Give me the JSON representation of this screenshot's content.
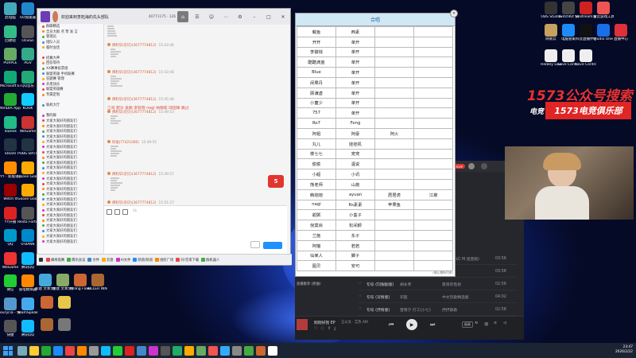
{
  "desktop_left": {
    "col1": [
      "此电脑",
      "回收站",
      "PURPLE",
      "Microsoft Edge",
      "NVIDIA App",
      "ToDesk",
      "Steam",
      "YY - 新版语音",
      "Witch It",
      "YY开播",
      "QQ",
      "WeGame",
      "微信",
      "eurycia - 快捷方式",
      "快捷"
    ],
    "col2": [
      "UU加速器",
      "Oculus",
      "AGV",
      "QQ音乐",
      "KOOK",
      "WeGame",
      "PUBG BATTLEGRO...",
      "Goose Goose Duck",
      "Goose Goose Duck",
      "Resto Fortune",
      "U-BANK",
      "腾讯QQ",
      "雷电模拟器",
      "TeamSpeak 3",
      "腾讯QQ"
    ],
    "col3": [
      "",
      "",
      "",
      "",
      "",
      "",
      "",
      "",
      "",
      "",
      "",
      "新建 文本文档",
      "新建 文本文档",
      "Killing Floor Beta Cook...",
      "KILLER INN BETA"
    ],
    "col3_colors": [
      "#b44",
      "#55a",
      "#fa0",
      "#3a8",
      "#e44",
      "#f80",
      "#48c",
      "#e8c84a",
      "#888",
      "#4a4",
      "#2a6",
      "#4ad",
      "#8a6",
      "#c63",
      "#a63"
    ]
  },
  "desktop_right": {
    "icons": [
      "OBS Studio",
      "TwitchKit 快捷方式",
      "Restream 快捷方式",
      "雷云游戏工具",
      "网易云",
      "电脑管家",
      "抖音直播伴侣",
      "Studio One 5",
      "直播中心",
      "HeiBey Love Contr...",
      "Love Control-R...",
      "Love Control-R..."
    ],
    "promo_line1": "1573公众号搜索",
    "promo_logo": "电竞",
    "promo_line2": "1573电竞俱乐部"
  },
  "chat": {
    "title": "欢迎来到李拓海的先头部队",
    "stats": "40771175 · 126",
    "input_placeholder": "Sk",
    "messages": [
      {
        "name": "佛利华(宗贝)(3677774812)",
        "time": "15:43:46"
      },
      {
        "name": "佛利华(宗贝)(3677774812)",
        "time": "15:43:48"
      },
      {
        "name": "佛利华(宗贝)(3677774812)",
        "time": "15:45:46",
        "body": "江哥 配对 姜鹏 李智晓 nagi 纳御帮 邱田铼 跳过"
      },
      {
        "name": "佛利华(宗贝)(3677774812)",
        "time": "15:49:53"
      },
      {
        "name": "阿福(77421006)",
        "time": "15:49:55"
      },
      {
        "name": "佛利华(宗贝)(3677774812)",
        "time": "15:49:57"
      },
      {
        "name": "佛利华(宗贝)(3677774812)",
        "time": "15:51:27"
      }
    ],
    "groups": [
      "群聊精选",
      "全员大群 点 赞 发 言",
      "管理员",
      "组队人员",
      "临时会话",
      "",
      "招募大神",
      "回答等待",
      "XX赛事投票组",
      "联盟英雄 手机联赛",
      "答题赛 管理",
      "开黑快乐",
      "联盟英雄赛",
      "专属定制",
      "",
      "联机大厅",
      "",
      "我的群",
      "大家大家好的朋友们",
      "大家大家好的朋友们",
      "大家大家好的朋友们",
      "大家大家好的朋友们",
      "大家大家好的朋友们",
      "大家大家好的朋友们",
      "大家大家好的朋友们",
      "大家大家好的朋友们",
      "大家大家好的朋友们",
      "大家大家好的朋友们",
      "大家大家好的朋友们",
      "大家大家好的朋友们",
      "大家大家好的朋友们",
      "大家大家好的朋友们",
      "大家大家好的朋友们",
      "大家大家好的朋友们",
      "大家大家好的朋友们",
      "大家大家好的朋友们",
      "大家大家好的朋友们",
      "大家大家好的朋友们",
      "大家大家好的朋友们",
      "大家大家好的朋友们",
      "大家大家好的朋友们",
      "大家大家好的朋友们"
    ],
    "bottom_bar": [
      "",
      "蜂窝观赛",
      "腾讯会议",
      "文件",
      "云盘",
      "AI文件",
      "频道/频道",
      "组织广场",
      "开/完来下载",
      "群机器人"
    ]
  },
  "roster": {
    "title": "合唱",
    "footer": "(确认最新列表)",
    "rows": [
      [
        "鲅鱼",
        "西素",
        "",
        ""
      ],
      [
        "开开",
        "单开",
        "",
        ""
      ],
      [
        "李徽钱",
        "单开",
        "",
        ""
      ],
      [
        "酷酷滴蓝",
        "单开",
        "",
        ""
      ],
      [
        "Blue",
        "单开",
        "",
        ""
      ],
      [
        "闲果丹",
        "单开",
        "",
        ""
      ],
      [
        "顾谦虚",
        "单开",
        "",
        ""
      ],
      [
        "小童少",
        "单开",
        "",
        ""
      ],
      [
        "757",
        "单开",
        "",
        ""
      ],
      [
        "Ro7",
        "Feng",
        "",
        ""
      ],
      [
        "阿祖",
        "阿豪",
        "阿火",
        ""
      ],
      [
        "丸儿",
        "娃娃机",
        "",
        ""
      ],
      [
        "楼七七",
        "宠宠",
        "",
        ""
      ],
      [
        "偷偷",
        "温说",
        "",
        ""
      ],
      [
        "小超",
        "小讯",
        "",
        ""
      ],
      [
        "熊老师",
        "山炮",
        "",
        ""
      ],
      [
        "韩炮炮",
        "ayuan",
        "居居虎",
        "江黛"
      ],
      [
        "nagi",
        "Rs素素",
        "苹果鱼",
        ""
      ],
      [
        "甜粥",
        "小盒子",
        "",
        ""
      ],
      [
        "倪莫尚",
        "松间鲟",
        "",
        ""
      ],
      [
        "兰施",
        "东子",
        "",
        ""
      ],
      [
        "阿猫",
        "若若",
        "",
        ""
      ],
      [
        "仙某人",
        "獅子",
        "",
        ""
      ],
      [
        "图灵",
        "安可",
        "",
        ""
      ]
    ]
  },
  "player": {
    "sidebar": [
      "直播歌单 (CMO)",
      "直播歌单 (原曲)"
    ],
    "tracks": [
      {
        "title": "",
        "artist": "",
        "album": "Cover (LC M.混音版)",
        "time": "03:56"
      },
      {
        "title": "",
        "artist": "",
        "album": "",
        "time": "03:58"
      },
      {
        "title": "句号 (DJ银剧版)",
        "artist": "胡永孝",
        "album": "夏夜的电视",
        "time": "02:56"
      },
      {
        "title": "句号 (深情版)",
        "artist": "邓超",
        "album": "中文热歌精选版",
        "time": "04:02"
      },
      {
        "title": "句号 (抒情版)",
        "artist": "苗雨宁 打工(小七)",
        "album": "抒抒歌歌",
        "time": "02:58"
      }
    ],
    "now_playing_title": "刚刚好我 EP",
    "now_playing_artist": "王以太 · 艾热 AIR",
    "quality": "极高",
    "lyric_btn": "词",
    "badge": "SVIP"
  },
  "taskbar": {
    "time": "23:47",
    "date": "2026/2/22"
  }
}
